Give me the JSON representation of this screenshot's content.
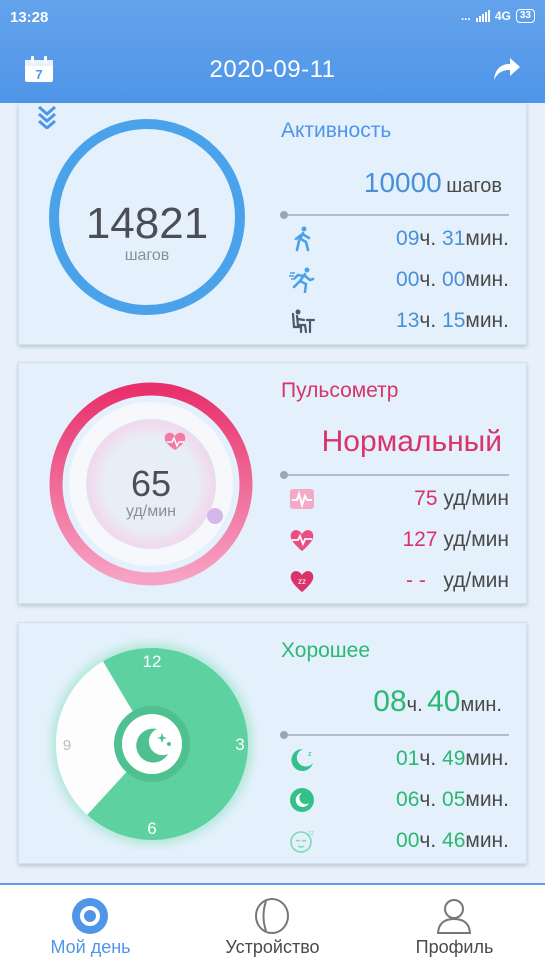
{
  "status_bar": {
    "time": "13:28",
    "dots": "...",
    "network": "4G",
    "battery": "33"
  },
  "header": {
    "date": "2020-09-11",
    "calendar_day": "7"
  },
  "activity": {
    "title": "Активность",
    "goal_value": "10000",
    "goal_unit": "шагов",
    "steps": "14821",
    "steps_unit": "шагов",
    "rows": [
      {
        "icon": "walking-icon",
        "h": "09",
        "h_unit": "ч.",
        "m": "31",
        "m_unit": "мин."
      },
      {
        "icon": "running-icon",
        "h": "00",
        "h_unit": "ч.",
        "m": "00",
        "m_unit": "мин."
      },
      {
        "icon": "sitting-icon",
        "h": "13",
        "h_unit": "ч.",
        "m": "15",
        "m_unit": "мин."
      }
    ]
  },
  "pulse": {
    "title": "Пульсометр",
    "status": "Нормальный",
    "value": "65",
    "unit": "уд/мин",
    "rows": [
      {
        "icon": "pulse-wave-icon",
        "value": "75",
        "unit": "уд/мин"
      },
      {
        "icon": "heart-rate-icon",
        "value": "127",
        "unit": "уд/мин"
      },
      {
        "icon": "heart-sleep-icon",
        "value": "- -",
        "unit": "уд/мин"
      }
    ]
  },
  "sleep": {
    "title": "Хорошее",
    "total_h": "08",
    "total_h_unit": "ч.",
    "total_m": "40",
    "total_m_unit": "мин.",
    "clock": {
      "n12": "12",
      "n3": "3",
      "n6": "6",
      "n9": "9"
    },
    "rows": [
      {
        "icon": "moon-icon",
        "h": "01",
        "h_unit": "ч.",
        "m": "49",
        "m_unit": "мин."
      },
      {
        "icon": "deep-sleep-icon",
        "h": "06",
        "h_unit": "ч.",
        "m": "05",
        "m_unit": "мин."
      },
      {
        "icon": "sleepy-face-icon",
        "h": "00",
        "h_unit": "ч.",
        "m": "46",
        "m_unit": "мин."
      }
    ]
  },
  "nav": [
    {
      "label": "Мой день",
      "icon": "my-day-icon",
      "active": true
    },
    {
      "label": "Устройство",
      "icon": "device-icon",
      "active": false
    },
    {
      "label": "Профиль",
      "icon": "profile-icon",
      "active": false
    }
  ],
  "colors": {
    "accent": "#4f95e8",
    "blue_value": "#4a90d9",
    "pink": "#e0336f",
    "green": "#2bb872",
    "green_ring": "#5fd3a0"
  }
}
